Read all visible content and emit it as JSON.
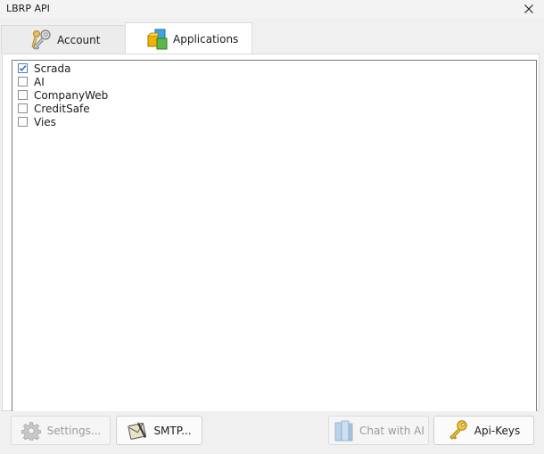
{
  "window": {
    "title": "LBRP API",
    "close_icon": "close-icon"
  },
  "tabs": [
    {
      "label": "Account",
      "icon": "key-icon",
      "active": false
    },
    {
      "label": "Applications",
      "icon": "cubes-icon",
      "active": true
    }
  ],
  "applications": [
    {
      "label": "Scrada",
      "checked": true
    },
    {
      "label": "AI",
      "checked": false
    },
    {
      "label": "CompanyWeb",
      "checked": false
    },
    {
      "label": "CreditSafe",
      "checked": false
    },
    {
      "label": "Vies",
      "checked": false
    }
  ],
  "buttons": {
    "settings": {
      "label": "Settings...",
      "icon": "gear-icon",
      "enabled": false
    },
    "smtp": {
      "label": "SMTP...",
      "icon": "mail-icon",
      "enabled": true
    },
    "chat_ai": {
      "label": "Chat with AI",
      "icon": "books-icon",
      "enabled": false
    },
    "api_keys": {
      "label": "Api-Keys",
      "icon": "key-icon",
      "enabled": true
    }
  },
  "colors": {
    "accent": "#2a63b8",
    "window_bg": "#f0f0f0",
    "panel_bg": "#ffffff"
  }
}
